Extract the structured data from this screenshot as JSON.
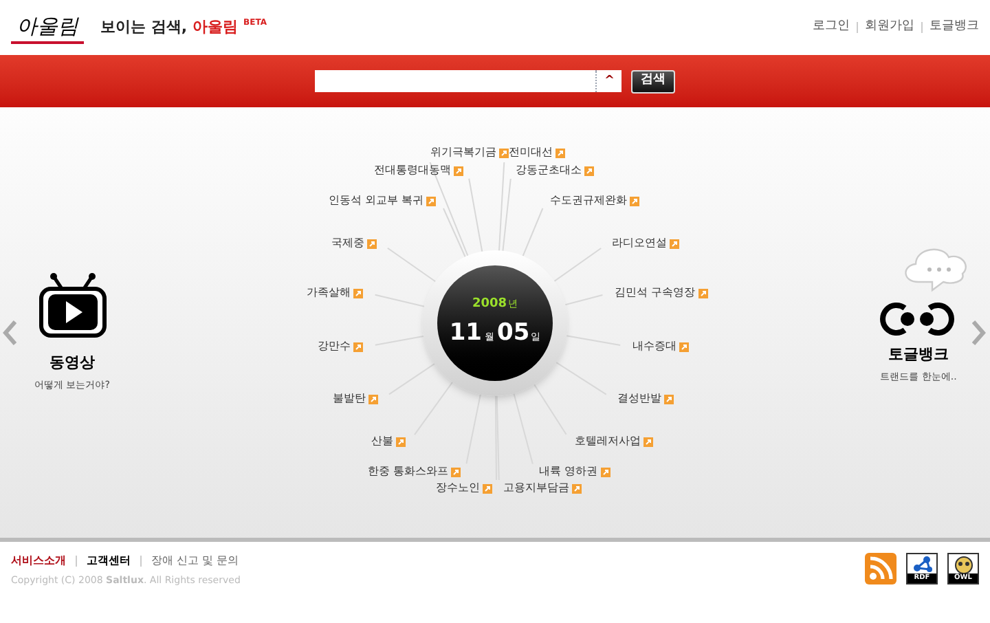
{
  "header": {
    "logo": "아울림",
    "tagline": "보이는 검색,",
    "brand": "아울림",
    "badge": "BETA",
    "links": [
      "로그인",
      "회원가입",
      "토글뱅크"
    ]
  },
  "search": {
    "button": "검색",
    "toggle": "^"
  },
  "date": {
    "year": "2008",
    "year_unit": "년",
    "month": "11",
    "month_unit": "월",
    "day": "05",
    "day_unit": "일"
  },
  "keywords": [
    "위기극복기금",
    "전미대선",
    "전대통령대동맥",
    "강동군초대소",
    "인동석 외교부 복귀",
    "수도권규제완화",
    "국제중",
    "라디오연설",
    "가족살해",
    "김민석 구속영장",
    "강만수",
    "내수증대",
    "불발탄",
    "결성반발",
    "산불",
    "호텔레저사업",
    "한중 통화스와프",
    "내륙 영하권",
    "장수노인",
    "고용지부담금"
  ],
  "left_panel": {
    "title": "동영상",
    "subtitle": "어떻게 보는거야?"
  },
  "right_panel": {
    "title": "토글뱅크",
    "subtitle": "트랜드를 한눈에.."
  },
  "footer": {
    "links": [
      {
        "label": "서비스소개",
        "kind": "accent"
      },
      {
        "label": "고객센터",
        "kind": "strong"
      },
      {
        "label": "장애 신고 및 문의",
        "kind": "plain"
      }
    ],
    "copyright": "Copyright (C) 2008 **Saltlux**. All Rights reserved",
    "badges": [
      "RDF",
      "OWL"
    ]
  }
}
